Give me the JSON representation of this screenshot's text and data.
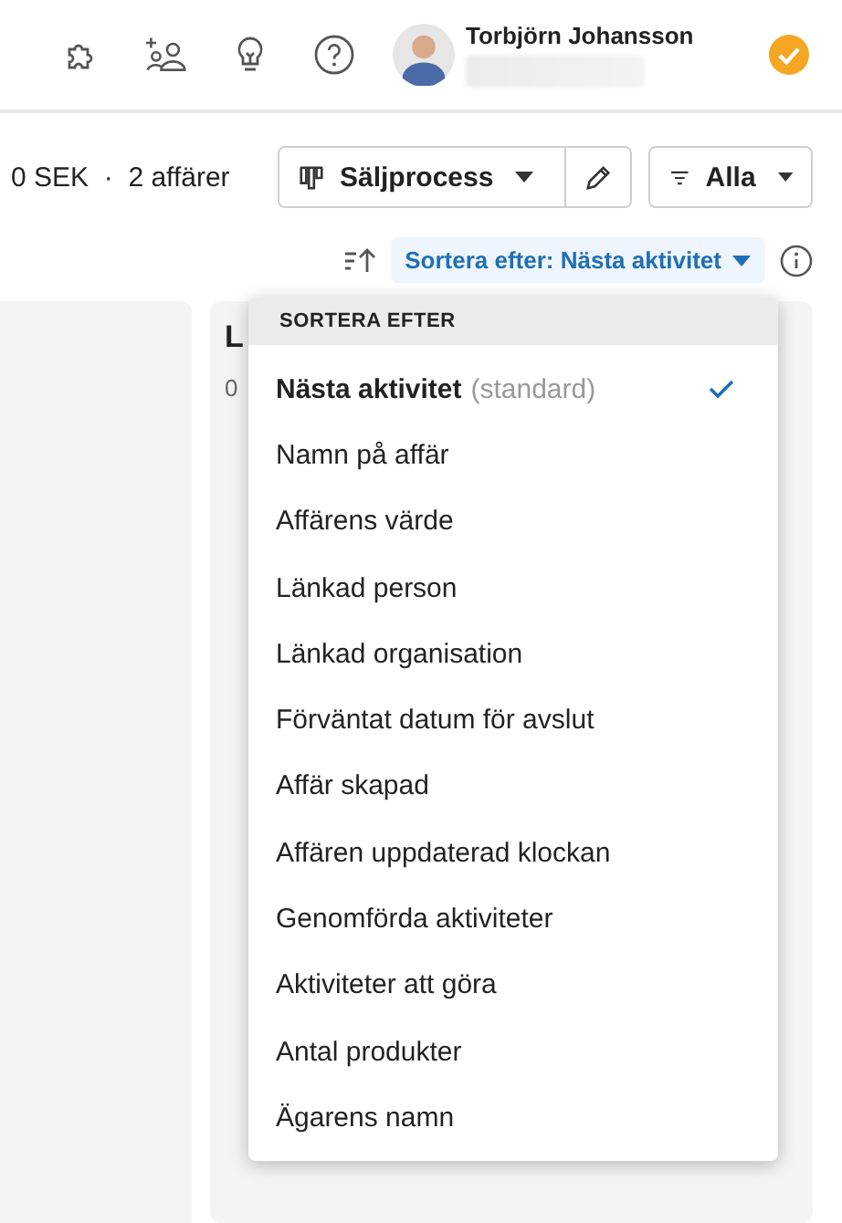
{
  "header": {
    "user_name": "Torbjörn Johansson"
  },
  "summary": {
    "value": "0 SEK",
    "separator": "·",
    "deals": "2 affärer"
  },
  "toolbar": {
    "pipeline": "Säljprocess",
    "filter": "Alla"
  },
  "sort": {
    "label": "Sortera efter: Nästa aktivitet"
  },
  "column": {
    "title": "L",
    "amount": "0"
  },
  "menu": {
    "heading": "SORTERA EFTER",
    "items": [
      {
        "label": "Nästa aktivitet",
        "note": "(standard)",
        "selected": true
      },
      {
        "label": "Namn på affär",
        "selected": false
      },
      {
        "label": "Affärens värde",
        "selected": false
      },
      {
        "label": "Länkad person",
        "selected": false
      },
      {
        "label": "Länkad organisation",
        "selected": false
      },
      {
        "label": "Förväntat datum för avslut",
        "selected": false
      },
      {
        "label": "Affär skapad",
        "selected": false
      },
      {
        "label": "Affären uppdaterad klockan",
        "selected": false
      },
      {
        "label": "Genomförda aktiviteter",
        "selected": false
      },
      {
        "label": "Aktiviteter att göra",
        "selected": false
      },
      {
        "label": "Antal produkter",
        "selected": false
      },
      {
        "label": "Ägarens namn",
        "selected": false
      }
    ]
  }
}
